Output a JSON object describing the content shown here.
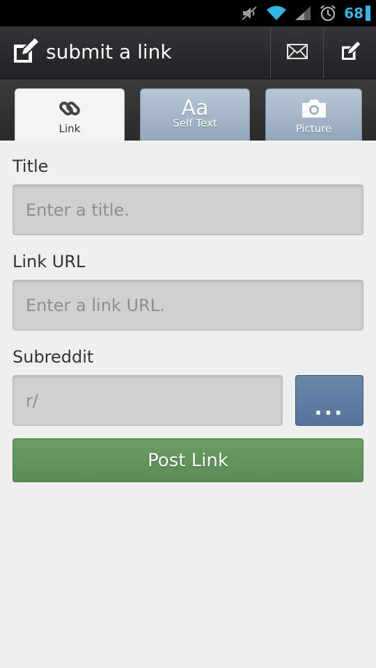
{
  "status_bar": {
    "battery_level": "68",
    "icons": [
      "muted-icon",
      "wifi-icon",
      "signal-icon",
      "alarm-icon",
      "battery-icon"
    ],
    "battery_color": "#33b5e5"
  },
  "action_bar": {
    "title": "submit a link",
    "app_icon": "compose-icon",
    "actions": [
      "mail-icon",
      "compose-icon"
    ]
  },
  "tabs": [
    {
      "label": "Link",
      "icon": "link-icon",
      "active": true
    },
    {
      "label": "Self Text",
      "icon": "text-icon",
      "glyph": "Aa",
      "active": false
    },
    {
      "label": "Picture",
      "icon": "camera-icon",
      "active": false
    }
  ],
  "form": {
    "title_label": "Title",
    "title_placeholder": "Enter a title.",
    "url_label": "Link URL",
    "url_placeholder": "Enter a link URL.",
    "subreddit_label": "Subreddit",
    "subreddit_placeholder": "r/",
    "more_button_label": "...",
    "post_button_label": "Post Link"
  },
  "colors": {
    "post_button": "#5f9159",
    "more_button": "#5f7c9f",
    "tab_inactive": "#a3b4c8"
  }
}
